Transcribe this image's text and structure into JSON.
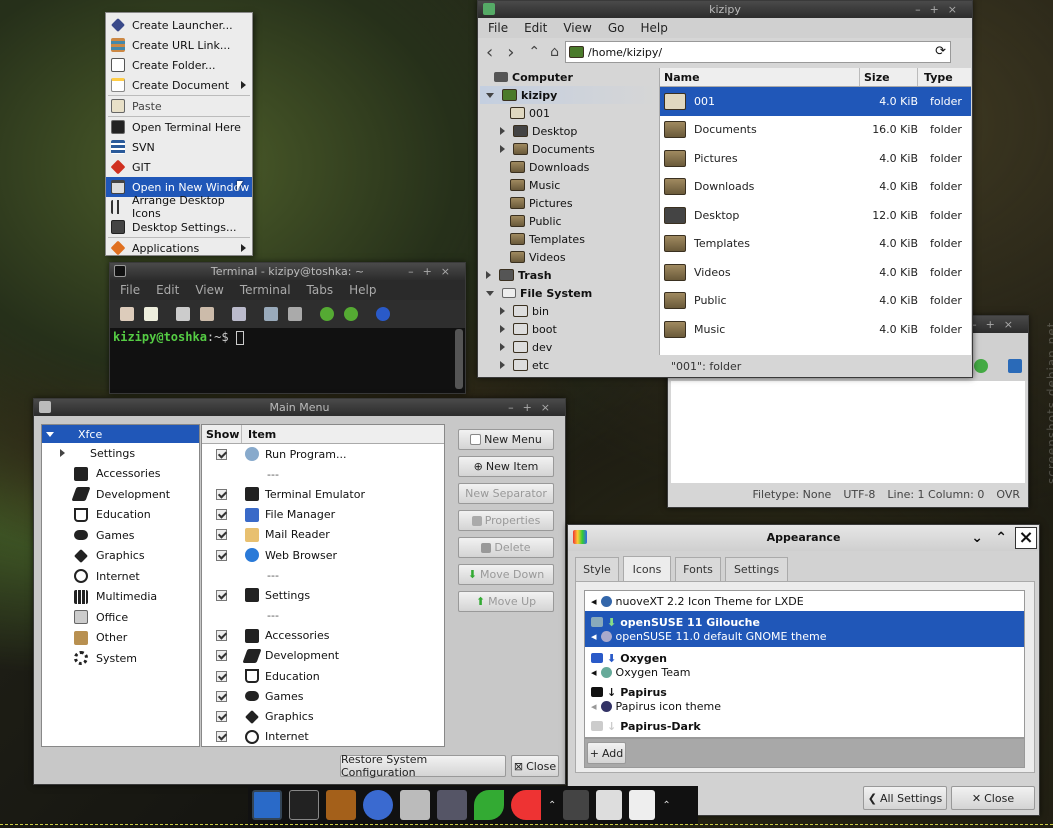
{
  "context_menu": {
    "items": [
      "Create Launcher...",
      "Create URL Link...",
      "Create Folder...",
      "Create Document",
      "Paste",
      "Open Terminal Here",
      "SVN",
      "GIT",
      "Open in New Window",
      "Arrange Desktop Icons",
      "Desktop Settings...",
      "Applications"
    ]
  },
  "file_manager": {
    "title": "kizipy",
    "menu": [
      "File",
      "Edit",
      "View",
      "Go",
      "Help"
    ],
    "path": "/home/kizipy/",
    "sidebar": [
      {
        "label": "Computer",
        "kind": "header"
      },
      {
        "label": "kizipy",
        "kind": "header"
      },
      {
        "label": "001"
      },
      {
        "label": "Desktop"
      },
      {
        "label": "Documents"
      },
      {
        "label": "Downloads"
      },
      {
        "label": "Music"
      },
      {
        "label": "Pictures"
      },
      {
        "label": "Public"
      },
      {
        "label": "Templates"
      },
      {
        "label": "Videos"
      },
      {
        "label": "Trash",
        "kind": "header"
      },
      {
        "label": "File System",
        "kind": "header"
      },
      {
        "label": "bin"
      },
      {
        "label": "boot"
      },
      {
        "label": "dev"
      },
      {
        "label": "etc"
      }
    ],
    "columns": [
      "Name",
      "Size",
      "Type"
    ],
    "files": [
      {
        "name": "001",
        "size": "4.0 KiB",
        "type": "folder"
      },
      {
        "name": "Documents",
        "size": "16.0 KiB",
        "type": "folder"
      },
      {
        "name": "Pictures",
        "size": "4.0 KiB",
        "type": "folder"
      },
      {
        "name": "Downloads",
        "size": "4.0 KiB",
        "type": "folder"
      },
      {
        "name": "Desktop",
        "size": "12.0 KiB",
        "type": "folder"
      },
      {
        "name": "Templates",
        "size": "4.0 KiB",
        "type": "folder"
      },
      {
        "name": "Videos",
        "size": "4.0 KiB",
        "type": "folder"
      },
      {
        "name": "Public",
        "size": "4.0 KiB",
        "type": "folder"
      },
      {
        "name": "Music",
        "size": "4.0 KiB",
        "type": "folder"
      }
    ],
    "status": "\"001\": folder"
  },
  "terminal": {
    "title": "Terminal - kizipy@toshka: ~",
    "menu": [
      "File",
      "Edit",
      "View",
      "Terminal",
      "Tabs",
      "Help"
    ],
    "prompt_user": "kizipy@toshka",
    "prompt_rest": ":~$"
  },
  "editor": {
    "status": {
      "filetype": "Filetype: None",
      "encoding": "UTF-8",
      "position": "Line: 1 Column: 0",
      "mode": "OVR"
    }
  },
  "main_menu": {
    "title": "Main Menu",
    "root": "Xfce",
    "categories": [
      "Settings",
      "Accessories",
      "Development",
      "Education",
      "Games",
      "Graphics",
      "Internet",
      "Multimedia",
      "Office",
      "Other",
      "System"
    ],
    "columns": [
      "Show",
      "Item"
    ],
    "items": [
      {
        "label": "Run Program...",
        "check": true
      },
      {
        "label": "---",
        "check": false
      },
      {
        "label": "Terminal Emulator",
        "check": true
      },
      {
        "label": "File Manager",
        "check": true
      },
      {
        "label": "Mail Reader",
        "check": true
      },
      {
        "label": "Web Browser",
        "check": true
      },
      {
        "label": "---",
        "check": false
      },
      {
        "label": "Settings",
        "check": true
      },
      {
        "label": "---",
        "check": false
      },
      {
        "label": "Accessories",
        "check": true
      },
      {
        "label": "Development",
        "check": true
      },
      {
        "label": "Education",
        "check": true
      },
      {
        "label": "Games",
        "check": true
      },
      {
        "label": "Graphics",
        "check": true
      },
      {
        "label": "Internet",
        "check": true
      }
    ],
    "buttons": {
      "new_menu": "New Menu",
      "new_item": "New Item",
      "new_separator": "New Separator",
      "properties": "Properties",
      "delete": "Delete",
      "move_down": "Move Down",
      "move_up": "Move Up"
    },
    "restore": "Restore System Configuration",
    "close": "Close"
  },
  "appearance": {
    "title": "Appearance",
    "tabs": [
      "Style",
      "Icons",
      "Fonts",
      "Settings"
    ],
    "themes": [
      {
        "name": "nuoveXT 2.2 Icon Theme for LXDE",
        "desc": ""
      },
      {
        "name": "openSUSE 11 Gilouche",
        "desc": "openSUSE 11.0 default GNOME theme"
      },
      {
        "name": "Oxygen",
        "desc": "Oxygen Team"
      },
      {
        "name": "Papirus",
        "desc": "Papirus icon theme"
      },
      {
        "name": "Papirus-Dark",
        "desc": ""
      }
    ],
    "add": "Add",
    "all_settings": "All Settings",
    "close": "Close"
  },
  "watermark": "screenshots.debian.net",
  "colors": {
    "selection": "#2057b8",
    "prompt": "#55cc44"
  }
}
